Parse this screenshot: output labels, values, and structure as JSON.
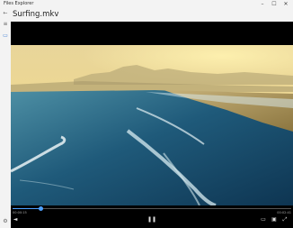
{
  "app": {
    "title": "Files Explorer"
  },
  "window_controls": {
    "minimize": "–",
    "maximize": "☐",
    "close": "✕"
  },
  "sidebar": {
    "back_icon": "←",
    "menu_icon": "≡",
    "folder_icon": "▭",
    "settings_icon": "⚙"
  },
  "page": {
    "title": "Surfing.mkv"
  },
  "player": {
    "current_time": "00:00:15",
    "total_time": "00:02:41",
    "progress": 0.1,
    "icons": {
      "volume": "◄",
      "play_pause": "❚❚",
      "cast": "▭",
      "pip": "▣",
      "fullscreen": "⤢"
    }
  },
  "colors": {
    "accent": "#4ea1ff",
    "player_bg": "#000000",
    "window_bg": "#f3f3f3"
  }
}
